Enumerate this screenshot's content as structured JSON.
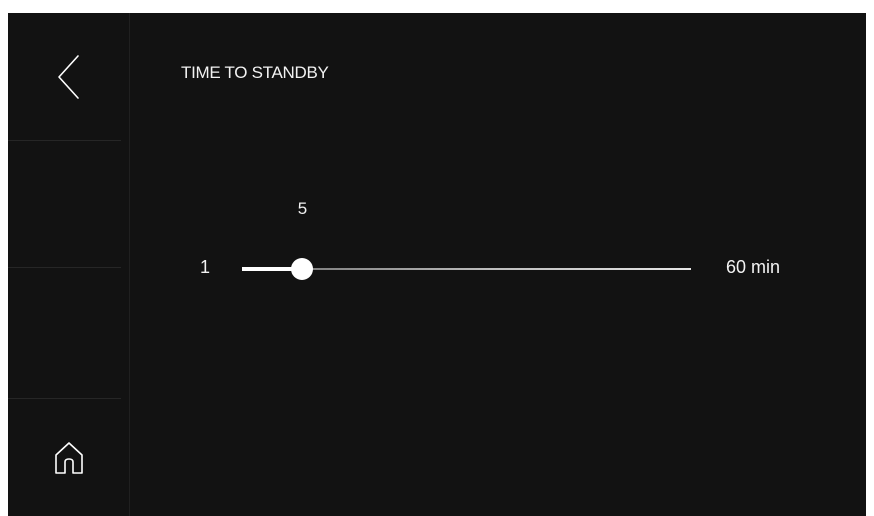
{
  "page": {
    "title": "TIME TO STANDBY"
  },
  "sidebar": {
    "back_icon": "chevron-left-icon",
    "home_icon": "home-icon"
  },
  "slider": {
    "min_label": "1",
    "max_label": "60 min",
    "min": 1,
    "max": 60,
    "value": 5,
    "value_label": "5"
  },
  "colors": {
    "background": "#121212",
    "text": "#f2f2f2",
    "accent": "#ffffff"
  }
}
